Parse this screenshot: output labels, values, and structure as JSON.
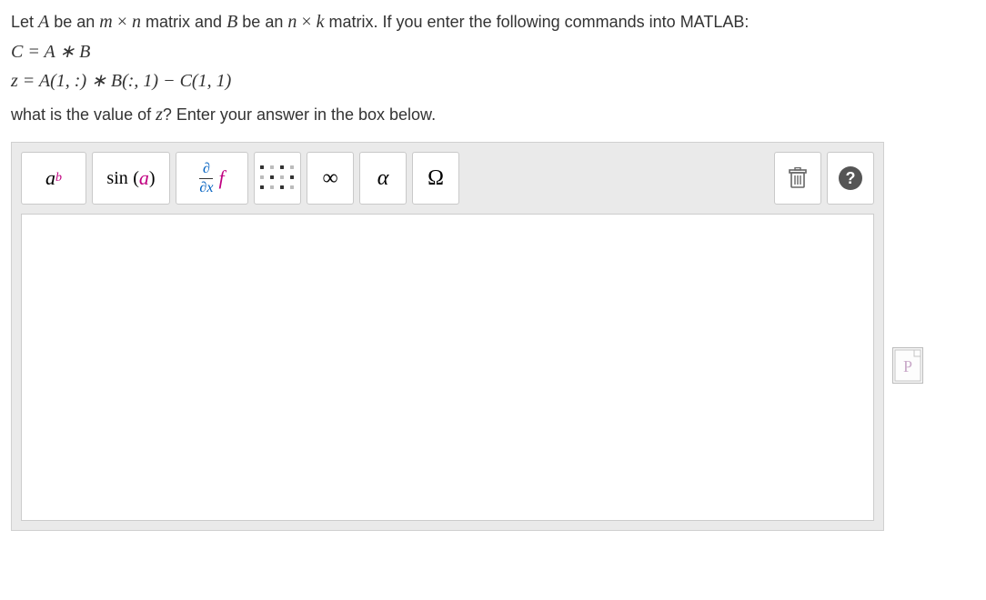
{
  "question": {
    "line1_prefix": "Let ",
    "A": "A",
    "be_an": " be an ",
    "m": "m",
    "times1": " × ",
    "n": "n",
    "matrix_and": " matrix and ",
    "B": "B",
    "be_an2": " be an ",
    "n2": "n",
    "times2": " × ",
    "k": "k",
    "matrix_suffix": " matrix.  If you enter the following commands into MATLAB:",
    "eq1": "C = A ∗ B",
    "eq2": "z = A(1, :) ∗ B(:, 1) − C(1, 1)",
    "prompt_prefix": "what is the value of ",
    "z": "z",
    "prompt_suffix": "?  Enter your answer in the box below."
  },
  "toolbar": {
    "exp_base": "a",
    "exp_sup": "b",
    "sin_label": "sin",
    "sin_arg_l": "(",
    "sin_arg": "a",
    "sin_arg_r": ")",
    "deriv_num": "∂",
    "deriv_den": "∂x",
    "deriv_f": "f",
    "infinity": "∞",
    "alpha": "α",
    "omega": "Ω",
    "help": "?"
  },
  "side_icon": "P"
}
